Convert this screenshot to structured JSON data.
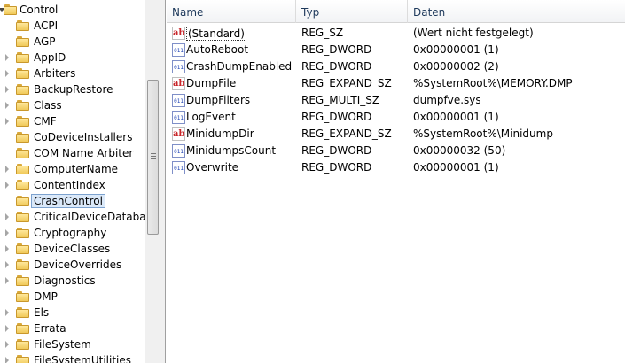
{
  "tree": {
    "root": "Control",
    "items": [
      {
        "label": "ACPI",
        "expandable": false
      },
      {
        "label": "AGP",
        "expandable": false
      },
      {
        "label": "AppID",
        "expandable": true
      },
      {
        "label": "Arbiters",
        "expandable": true
      },
      {
        "label": "BackupRestore",
        "expandable": true
      },
      {
        "label": "Class",
        "expandable": true
      },
      {
        "label": "CMF",
        "expandable": true
      },
      {
        "label": "CoDeviceInstallers",
        "expandable": false
      },
      {
        "label": "COM Name Arbiter",
        "expandable": false
      },
      {
        "label": "ComputerName",
        "expandable": true
      },
      {
        "label": "ContentIndex",
        "expandable": true
      },
      {
        "label": "CrashControl",
        "expandable": false,
        "selected": true
      },
      {
        "label": "CriticalDeviceDatabase",
        "expandable": true
      },
      {
        "label": "Cryptography",
        "expandable": true
      },
      {
        "label": "DeviceClasses",
        "expandable": true
      },
      {
        "label": "DeviceOverrides",
        "expandable": true
      },
      {
        "label": "Diagnostics",
        "expandable": true
      },
      {
        "label": "DMP",
        "expandable": false
      },
      {
        "label": "Els",
        "expandable": true
      },
      {
        "label": "Errata",
        "expandable": true
      },
      {
        "label": "FileSystem",
        "expandable": true
      },
      {
        "label": "FileSystemUtilities",
        "expandable": true
      }
    ]
  },
  "columns": {
    "name": "Name",
    "type": "Typ",
    "data": "Daten"
  },
  "values": [
    {
      "icon": "string-value-icon",
      "name": "(Standard)",
      "type": "REG_SZ",
      "data": "(Wert nicht festgelegt)"
    },
    {
      "icon": "binary-value-icon",
      "name": "AutoReboot",
      "type": "REG_DWORD",
      "data": "0x00000001 (1)"
    },
    {
      "icon": "binary-value-icon",
      "name": "CrashDumpEnabled",
      "type": "REG_DWORD",
      "data": "0x00000002 (2)"
    },
    {
      "icon": "string-value-icon",
      "name": "DumpFile",
      "type": "REG_EXPAND_SZ",
      "data": "%SystemRoot%\\MEMORY.DMP"
    },
    {
      "icon": "binary-value-icon",
      "name": "DumpFilters",
      "type": "REG_MULTI_SZ",
      "data": "dumpfve.sys"
    },
    {
      "icon": "binary-value-icon",
      "name": "LogEvent",
      "type": "REG_DWORD",
      "data": "0x00000001 (1)"
    },
    {
      "icon": "string-value-icon",
      "name": "MinidumpDir",
      "type": "REG_EXPAND_SZ",
      "data": "%SystemRoot%\\Minidump"
    },
    {
      "icon": "binary-value-icon",
      "name": "MinidumpsCount",
      "type": "REG_DWORD",
      "data": "0x00000032 (50)"
    },
    {
      "icon": "binary-value-icon",
      "name": "Overwrite",
      "type": "REG_DWORD",
      "data": "0x00000001 (1)"
    }
  ],
  "icons": {
    "string_glyph": "ab",
    "binary_glyph": "011\n110\n010"
  }
}
